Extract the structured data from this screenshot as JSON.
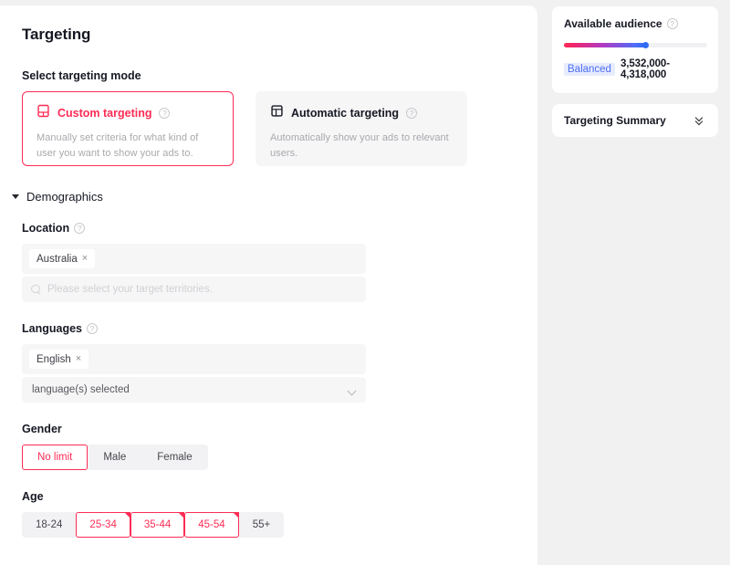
{
  "page": {
    "title": "Targeting"
  },
  "targeting_mode": {
    "label": "Select targeting mode",
    "options": [
      {
        "name": "Custom targeting",
        "description": "Manually set criteria for what kind of user you want to show your ads to.",
        "icon": "custom-targeting-icon",
        "selected": true,
        "help": "?"
      },
      {
        "name": "Automatic targeting",
        "description": "Automatically show your ads to relevant users.",
        "icon": "automatic-targeting-icon",
        "selected": false,
        "help": "?"
      }
    ]
  },
  "demographics": {
    "title": "Demographics",
    "expanded": true,
    "location": {
      "label": "Location",
      "help": "?",
      "tags": [
        "Australia"
      ],
      "tag_remove": "×",
      "search_placeholder": "Please select your target territories."
    },
    "languages": {
      "label": "Languages",
      "help": "?",
      "tags": [
        "English"
      ],
      "tag_remove": "×",
      "select_value": "language(s) selected"
    },
    "gender": {
      "label": "Gender",
      "options": [
        "No limit",
        "Male",
        "Female"
      ],
      "selected": "No limit"
    },
    "age": {
      "label": "Age",
      "options": [
        "18-24",
        "25-34",
        "35-44",
        "45-54",
        "55+"
      ],
      "selected": [
        "25-34",
        "35-44",
        "45-54"
      ]
    }
  },
  "side_panel": {
    "available_audience": {
      "title": "Available audience",
      "help": "?",
      "badge": "Balanced",
      "badge_bg": "#e7ecfd",
      "badge_color": "#4e6ef2",
      "range": "3,532,000-4,318,000",
      "slider_percent": 57
    },
    "targeting_summary": {
      "title": "Targeting Summary",
      "icon": "double-chevron-down-icon"
    }
  },
  "colors": {
    "accent": "#fe2c55",
    "text": "#161823",
    "muted": "#a8a9ad",
    "field_bg": "#f6f6f7",
    "page_bg": "#f1f1f2"
  }
}
